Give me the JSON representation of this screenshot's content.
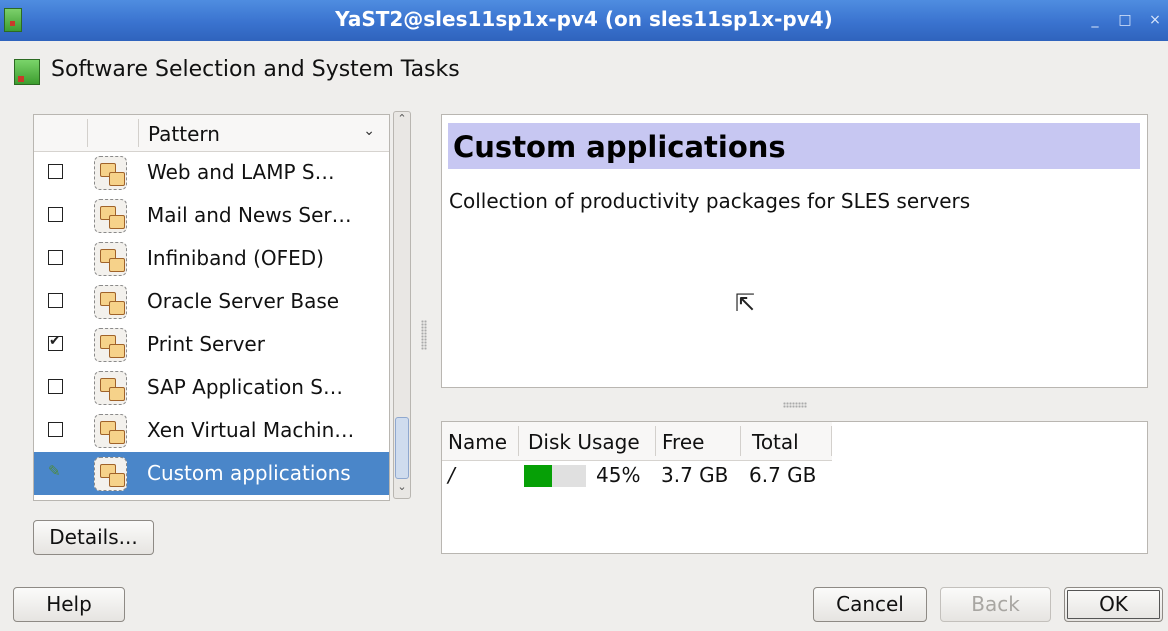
{
  "window": {
    "title": "YaST2@sles11sp1x-pv4 (on sles11sp1x-pv4)",
    "controls": [
      "_",
      "□",
      "×"
    ]
  },
  "heading": "Software Selection and System Tasks",
  "pattern_list": {
    "column_header": "Pattern",
    "rows": [
      {
        "label": "Web and LAMP S…",
        "state": "unchecked",
        "icon": "pattern-folder-icon"
      },
      {
        "label": "Mail and News Ser…",
        "state": "unchecked",
        "icon": "pattern-folder-icon"
      },
      {
        "label": "Infiniband (OFED)",
        "state": "unchecked",
        "icon": "pattern-folder-icon"
      },
      {
        "label": "Oracle Server Base",
        "state": "unchecked",
        "icon": "pattern-folder-icon"
      },
      {
        "label": "Print Server",
        "state": "checked",
        "icon": "pattern-folder-icon"
      },
      {
        "label": "SAP Application S…",
        "state": "unchecked",
        "icon": "pattern-folder-icon"
      },
      {
        "label": "Xen Virtual Machin…",
        "state": "unchecked",
        "icon": "pattern-folder-icon"
      },
      {
        "label": "Custom applications",
        "state": "auto",
        "icon": "pattern-folder-icon",
        "selected": true
      }
    ]
  },
  "details_button": "Details...",
  "description": {
    "title": "Custom applications",
    "body": "Collection of productivity packages for SLES servers"
  },
  "disk_usage": {
    "columns": [
      "Name",
      "Disk Usage",
      "Free",
      "Total"
    ],
    "rows": [
      {
        "name": "/",
        "usage_percent": 45,
        "usage_label": "45%",
        "free": "3.7 GB",
        "total": "6.7 GB"
      }
    ]
  },
  "buttons": {
    "help": "Help",
    "cancel": "Cancel",
    "back": "Back",
    "ok": "OK"
  },
  "colors": {
    "selection": "#4a86c9",
    "title_highlight": "#c7c7f2",
    "usage_bar": "#06a006"
  }
}
